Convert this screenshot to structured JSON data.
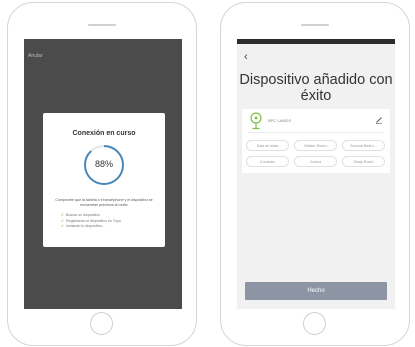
{
  "connecting": {
    "cancel_label": "Anular",
    "dialog_title": "Conexión en curso",
    "progress_percent": 88,
    "progress_text": "88%",
    "description": "Compruebe que la tableta o el smartphone y el dispositivo se encuentran próximos al router",
    "steps": [
      {
        "label": "Buscar un dispositivo",
        "done": true
      },
      {
        "label": "Registrando el dispositivo en Tuya",
        "done": true
      },
      {
        "label": "Iniciando tu dispositivo...",
        "done": true
      }
    ],
    "accent_color": "#7cbf45",
    "ring_color": "#4a88b8"
  },
  "added": {
    "title": "Dispositivo añadido con éxito",
    "device_name": "BPC LAMDS",
    "device_icon": "floor-fan-icon",
    "rooms": [
      "Sala de estar",
      "Master Room",
      "Second Bedro...",
      "Comedor",
      "Cocina",
      "Study Room"
    ],
    "done_label": "Hecho",
    "button_color": "#8d95a5",
    "accent_color": "#7cbf45"
  }
}
